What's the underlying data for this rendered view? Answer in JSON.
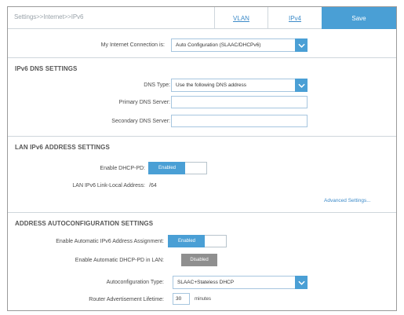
{
  "header": {
    "breadcrumb": "Settings>>Internet>>IPv6",
    "tabs": [
      {
        "label": "VLAN"
      },
      {
        "label": "IPv4"
      }
    ],
    "save_label": "Save"
  },
  "connection": {
    "label": "My Internet Connection is:",
    "value": "Auto Configuration (SLAAC/DHCPv6)"
  },
  "dns": {
    "title": "IPv6 DNS SETTINGS",
    "type_label": "DNS Type:",
    "type_value": "Use the following DNS address",
    "primary_label": "Primary DNS Server:",
    "primary_value": "",
    "secondary_label": "Secondary DNS Server:",
    "secondary_value": ""
  },
  "lan": {
    "title": "LAN IPv6 ADDRESS SETTINGS",
    "dhcp_pd_label": "Enable DHCP-PD:",
    "dhcp_pd_state": "Enabled",
    "link_local_label": "LAN IPv6 Link-Local Address:",
    "link_local_value": "/64",
    "advanced_link": "Advanced Settings..."
  },
  "autoconfig": {
    "title": "ADDRESS AUTOCONFIGURATION SETTINGS",
    "auto_assign_label": "Enable Automatic IPv6 Address Assignment:",
    "auto_assign_state": "Enabled",
    "auto_dhcp_pd_label": "Enable Automatic DHCP-PD in LAN:",
    "auto_dhcp_pd_state": "Disabled",
    "autoconfig_type_label": "Autoconfiguration Type:",
    "autoconfig_type_value": "SLAAC+Stateless DHCP",
    "lifetime_label": "Router Advertisement Lifetime:",
    "lifetime_value": "30",
    "lifetime_unit": "minutes"
  },
  "colors": {
    "accent": "#4a9fd5",
    "disabled": "#8f8f8f",
    "link": "#3d8bc9"
  }
}
